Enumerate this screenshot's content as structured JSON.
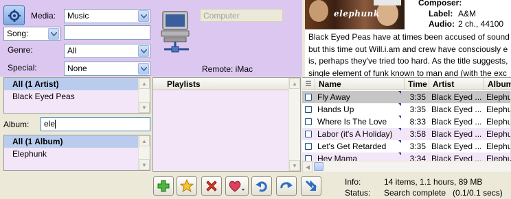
{
  "filters": {
    "media_label": "Media:",
    "media_value": "Music",
    "song_label": "Song:",
    "song_value": "",
    "genre_label": "Genre:",
    "genre_value": "All",
    "special_label": "Special:",
    "special_value": "None",
    "computer_placeholder": "Computer",
    "remote_label": "Remote: iMac"
  },
  "artists": {
    "header": "All (1 Artist)",
    "items": [
      "Black Eyed Peas"
    ]
  },
  "album_filter": {
    "label": "Album:",
    "value": "ele"
  },
  "albums": {
    "header": "All (1 Album)",
    "items": [
      "Elephunk"
    ]
  },
  "playlists": {
    "header": "Playlists"
  },
  "album_info": {
    "cover_text": "elephunk",
    "composer_label": "Composer:",
    "label_label": "Label:",
    "label_value": "A&M",
    "audio_label": "Audio:",
    "audio_value": "2 ch., 44100",
    "description_lines": [
      "Black Eyed Peas have at times been accused of sound",
      "but this time out Will.i.am and crew have consciously e",
      "is, perhaps they've tried too hard. As the title suggests,",
      "single element of funk known to man and (with the exc"
    ]
  },
  "tracks": {
    "columns": [
      "Name",
      "Time",
      "Artist",
      "Album"
    ],
    "rows": [
      {
        "name": "Fly Away",
        "time": "3:35",
        "artist": "Black Eyed ...",
        "album": "Elephu"
      },
      {
        "name": "Hands Up",
        "time": "3:35",
        "artist": "Black Eyed ...",
        "album": "Elephu"
      },
      {
        "name": "Where Is The Love",
        "time": "8:33",
        "artist": "Black Eyed ...",
        "album": "Elephu"
      },
      {
        "name": "Labor (it's A Holiday)",
        "time": "3:58",
        "artist": "Black Eyed ...",
        "album": "Elephu"
      },
      {
        "name": "Let's Get Retarded",
        "time": "3:35",
        "artist": "Black Eyed ...",
        "album": "Elephu"
      },
      {
        "name": "Hey Mama",
        "time": "3:34",
        "artist": "Black Eyed ...",
        "album": "Elephu"
      }
    ]
  },
  "status": {
    "info_label": "Info:",
    "info_value": "14 items, 1.1 hours, 89 MB",
    "status_label": "Status:",
    "status_value": "Search complete   (0.1/0.1 secs)"
  },
  "toolbar_icons": [
    "add-icon",
    "star-icon",
    "delete-icon",
    "heart-icon",
    "undo-icon",
    "redo-icon",
    "sync-icon"
  ],
  "colors": {
    "filter_bg": "#dcc7f0",
    "list_bg": "#f3e6f8",
    "selected_row": "#b9ccee",
    "row_alt": "#f3e6f8"
  }
}
